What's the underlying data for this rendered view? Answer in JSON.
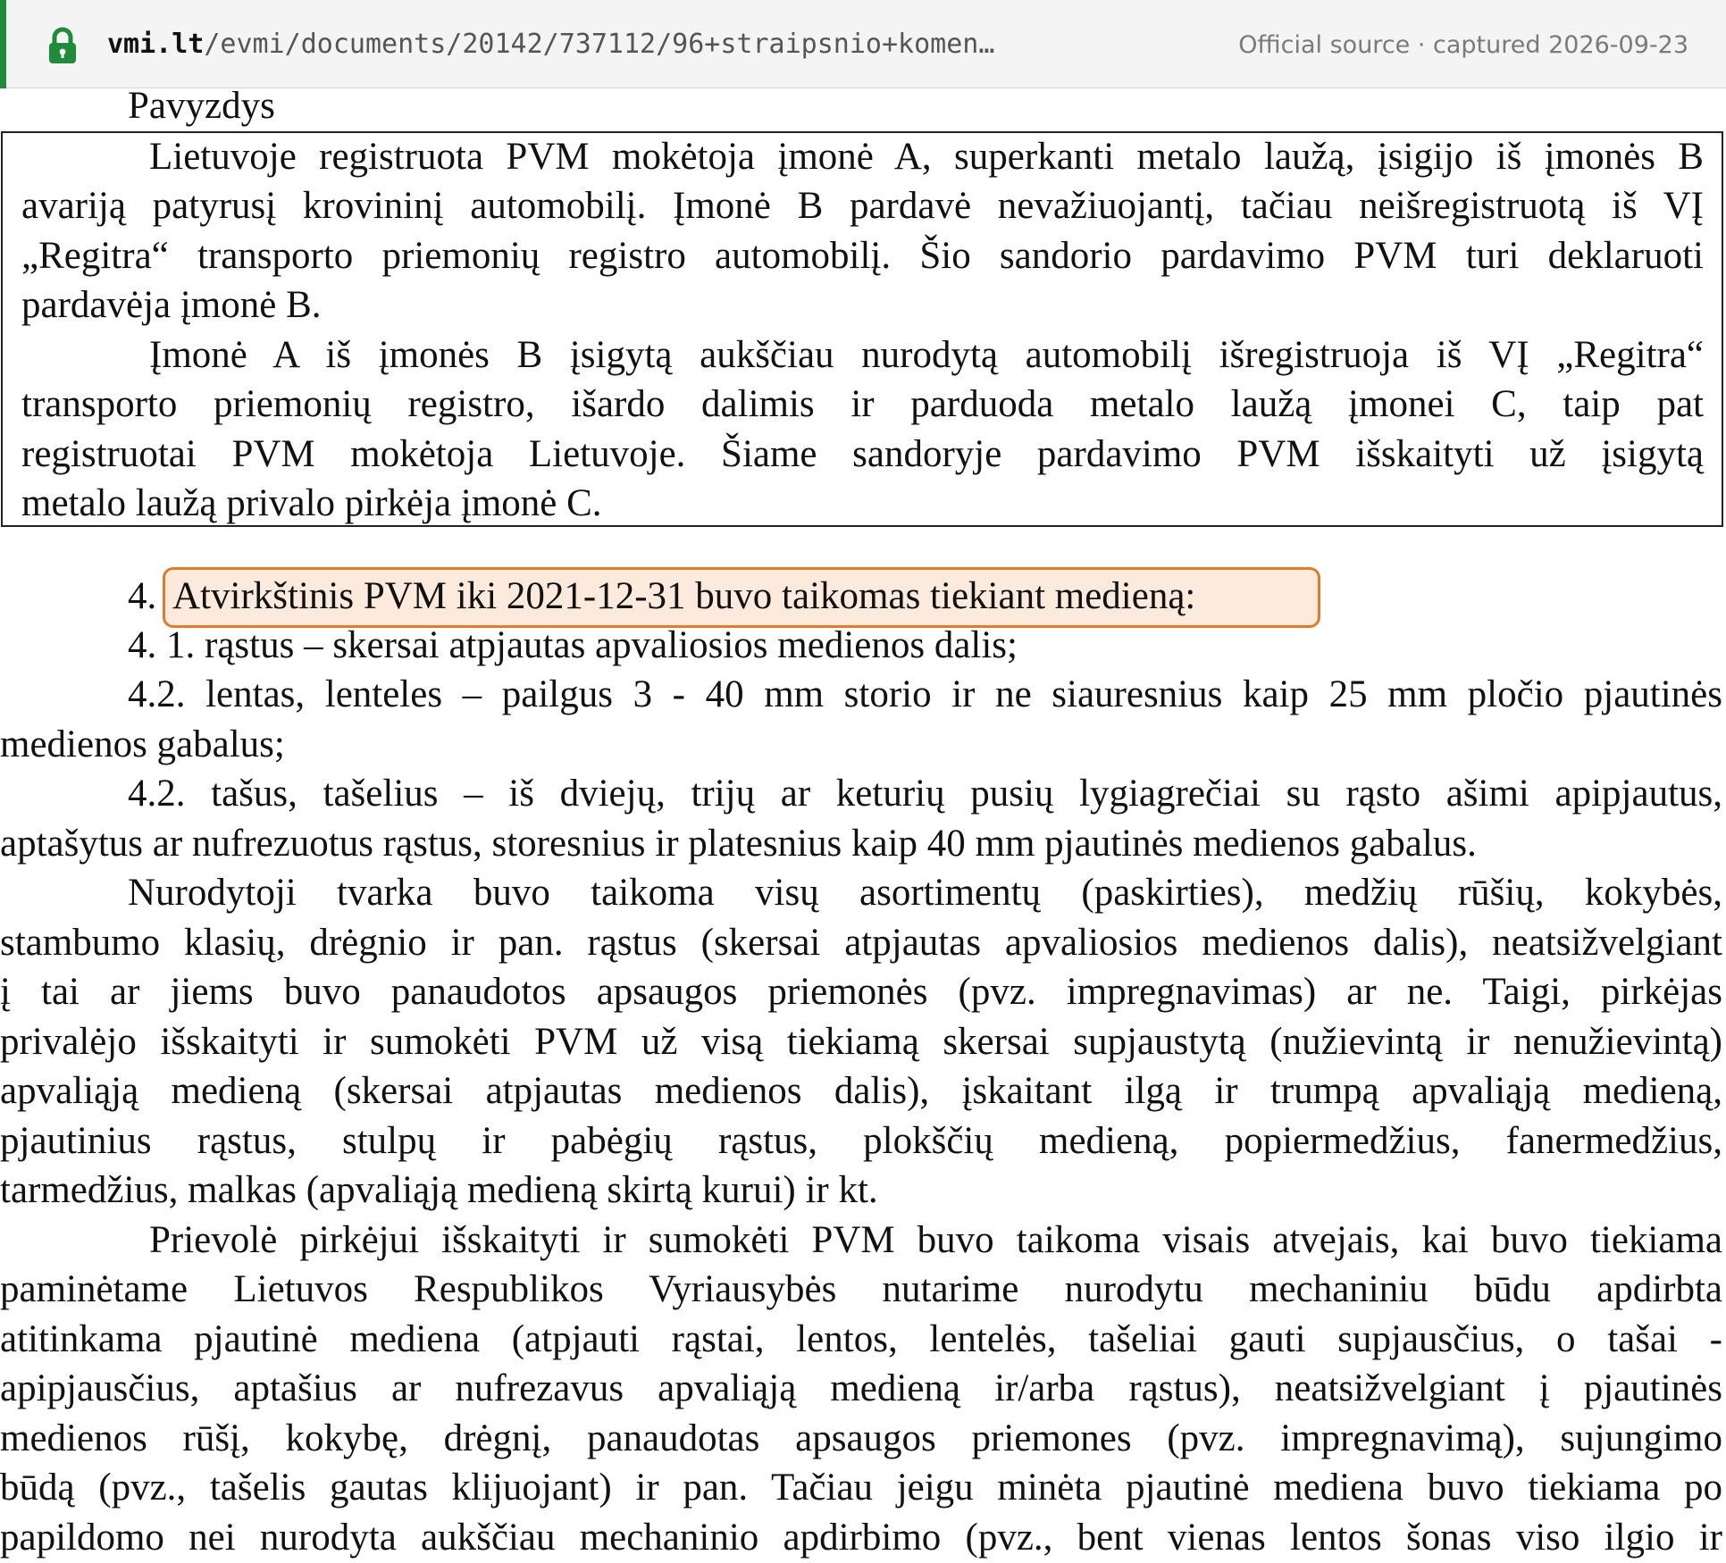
{
  "browser": {
    "domain": "vmi.lt",
    "path": "/evmi/documents/20142/737112/96+straipsnio+komen…",
    "capture_note": "Official source · captured 2026-09-23",
    "lock_icon": "lock-icon",
    "accent_color": "#1e8c3a"
  },
  "document": {
    "example_heading": "Pavyzdys",
    "example_box": {
      "lines": [
        "Lietuvoje registruota PVM mokėtoja įmonė A, superkanti metalo laužą, įsigijo iš įmonės B",
        "avariją patyrusį krovininį automobilį. Įmonė B pardavė nevažiuojantį, tačiau neišregistruotą iš VĮ",
        "„Regitra“ transporto priemonių registro automobilį. Šio sandorio pardavimo PVM turi deklaruoti",
        "pardavėja įmonė B.",
        "Įmonė A iš įmonės B įsigytą aukščiau nurodytą automobilį išregistruoja iš VĮ „Regitra“",
        "transporto priemonių registro, išardo dalimis ir parduoda metalo laužą įmonei C, taip pat",
        "registruotai PVM mokėtoja Lietuvoje. Šiame sandoryje pardavimo PVM išskaityti už įsigytą",
        "metalo laužą privalo pirkėja įmonė C."
      ]
    },
    "section4": {
      "number": "4.",
      "title": "Atvirkštinis PVM iki 2021-12-31 buvo taikomas tiekiant medieną:",
      "highlight_color": "#e07b2a"
    },
    "body_lines": [
      "4. 1. rąstus – skersai atpjautas apvaliosios medienos dalis;",
      "4.2. lentas, lenteles – pailgus 3 - 40 mm storio ir ne siauresnius kaip 25 mm pločio pjautinės",
      "medienos gabalus;",
      "4.2. tašus, tašelius – iš dviejų, trijų ar keturių pusių lygiagrečiai su rąsto ašimi apipjautus,",
      "aptašytus ar nufrezuotus rąstus, storesnius ir platesnius kaip 40 mm pjautinės medienos gabalus.",
      "Nurodytoji tvarka buvo taikoma visų asortimentų (paskirties), medžių rūšių, kokybės,",
      "stambumo klasių, drėgnio ir pan. rąstus (skersai atpjautas apvaliosios medienos dalis), neatsižvelgiant",
      "į tai ar jiems buvo panaudotos apsaugos priemonės (pvz. impregnavimas) ar ne. Taigi, pirkėjas",
      "privalėjo išskaityti ir sumokėti PVM už visą tiekiamą skersai supjaustytą (nužievintą ir nenužievintą)",
      "apvaliąją medieną (skersai atpjautas medienos dalis), įskaitant ilgą ir trumpą apvaliąją medieną,",
      "pjautinius rąstus, stulpų ir pabėgių rąstus, plokščių medieną, popiermedžius, fanermedžius,",
      "tarmedžius, malkas (apvaliąją medieną skirtą kurui) ir kt.",
      "Prievolė pirkėjui išskaityti ir sumokėti PVM buvo taikoma visais atvejais, kai buvo tiekiama",
      "paminėtame Lietuvos Respublikos Vyriausybės nutarime nurodytu mechaniniu būdu apdirbta",
      "atitinkama pjautinė mediena (atpjauti rąstai, lentos, lentelės, tašeliai gauti supjausčius, o tašai -",
      "apipjausčius, aptašius ar nufrezavus apvaliąją medieną ir/arba rąstus), neatsižvelgiant į pjautinės",
      "medienos rūšį, kokybę, drėgnį, panaudotas apsaugos priemones (pvz. impregnavimą), sujungimo",
      "būdą (pvz., tašelis gautas klijuojant) ir pan. Tačiau jeigu minėta pjautinė mediena buvo tiekiama po",
      "papildomo nei nurodyta aukščiau mechaninio apdirbimo (pvz., bent vienas lentos šonas viso ilgio ir"
    ]
  }
}
